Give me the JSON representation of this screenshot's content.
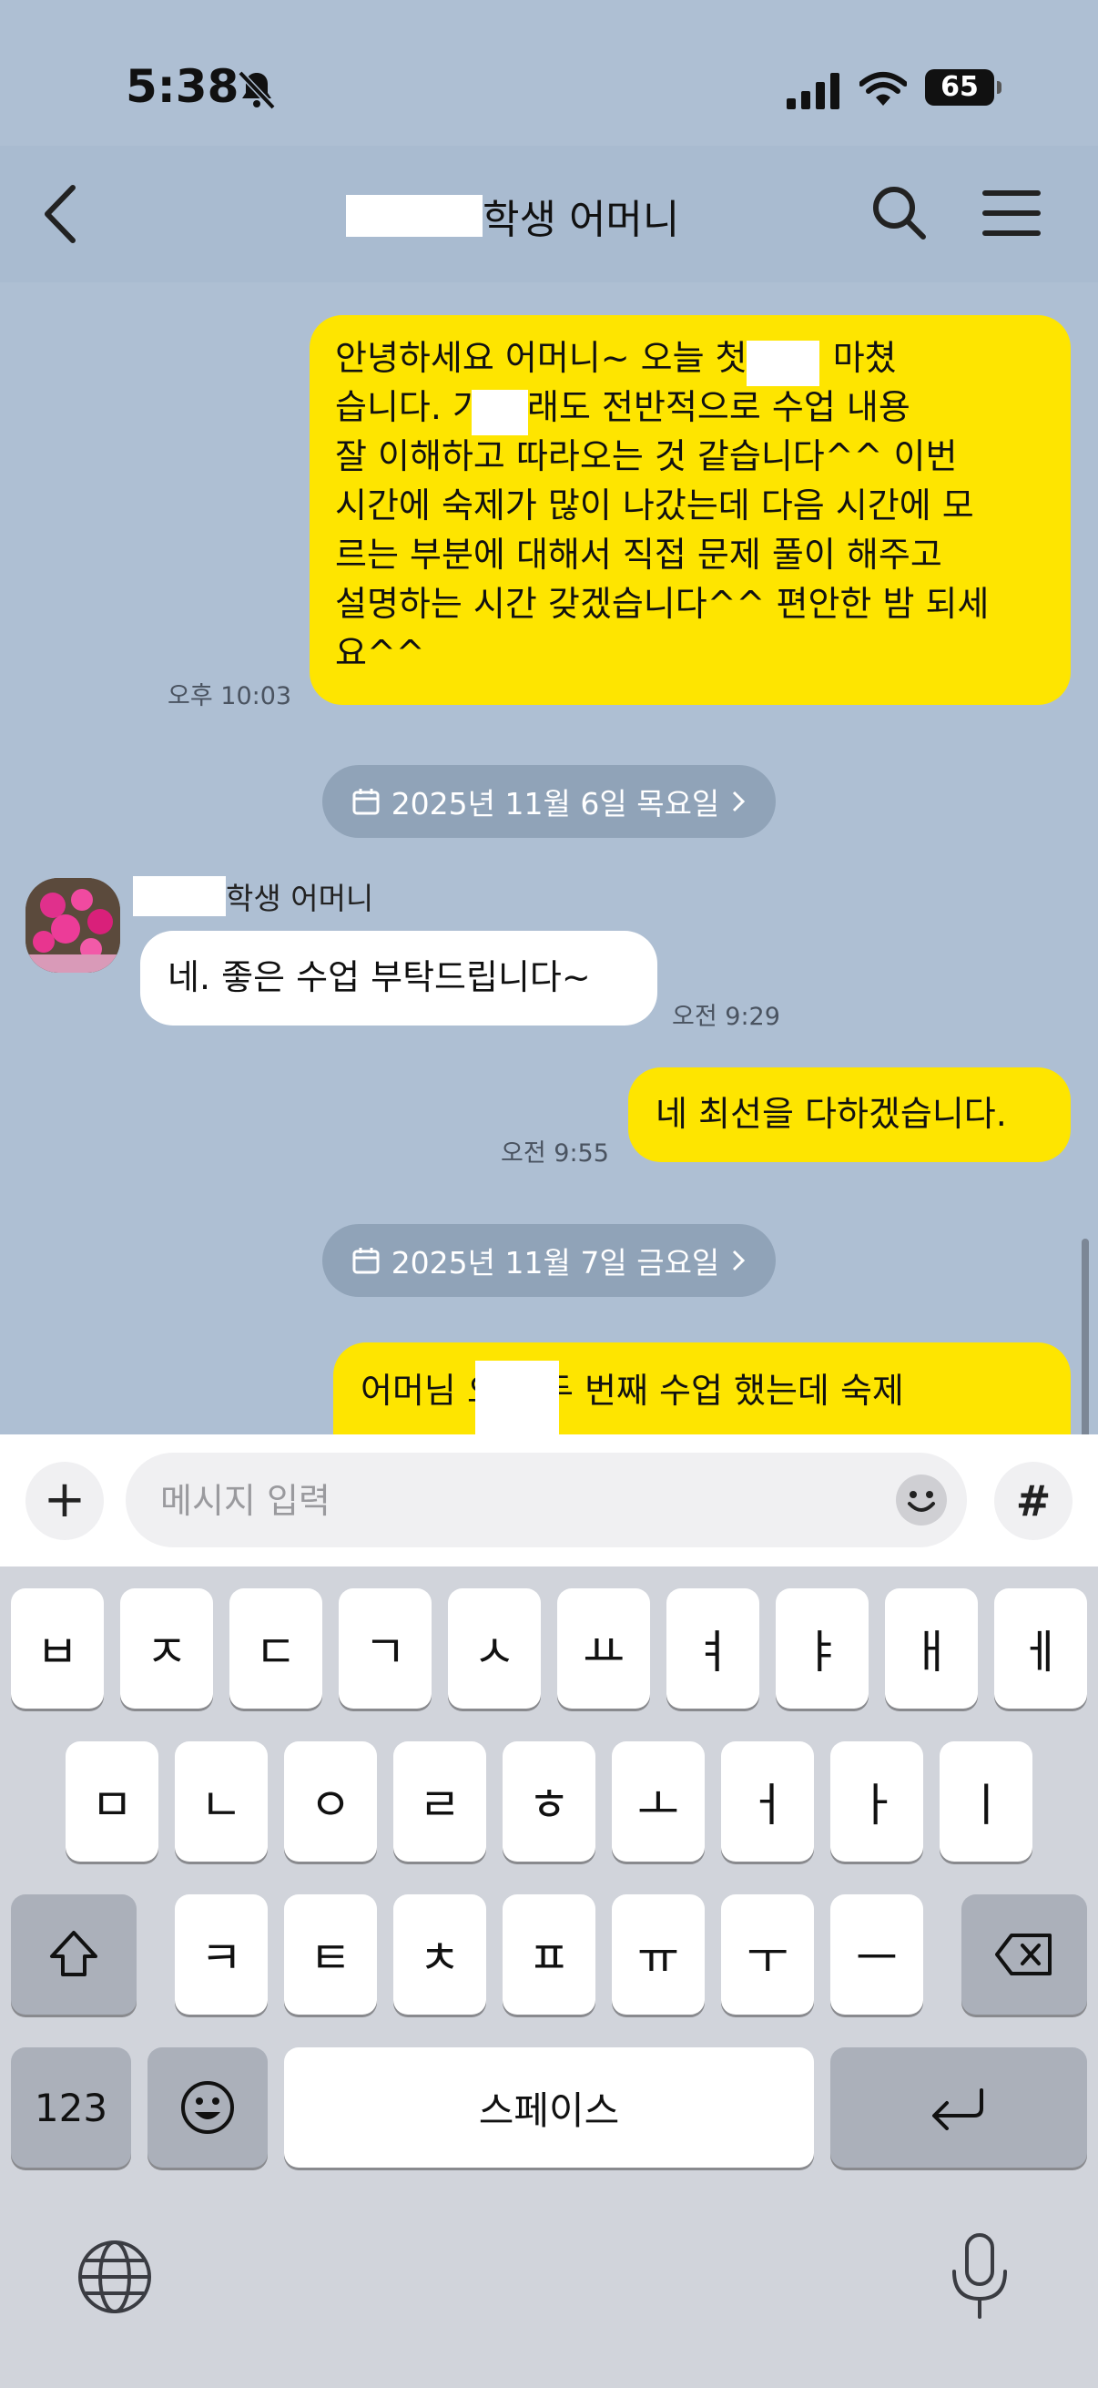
{
  "status": {
    "time": "5:38",
    "battery": "65"
  },
  "header": {
    "title": "학생  어머니"
  },
  "messages": [
    {
      "id": "m1",
      "side": "me",
      "text": "안녕하세요 어머니~ 오늘 ▢ 첫 수업 마쳤습니다. ▢가 그래도 전반적으로 수업 내용 잘 이해하고 따라오는 것 같습니다^^ 이번 시간에 숙제가 많이 나갔는데 다음 시간에 모르는 부분에 대해서 직접 문제 풀이 해주고 설명하는 시간 갖겠습니다^^ 편안한 밤 되세요^^",
      "lines": [
        "안녕하세요 어머니~ 오늘      첫 수업 마쳤",
        "습니다.       가 그래도 전반적으로 수업 내용",
        "잘 이해하고 따라오는 것 같습니다^^ 이번",
        "시간에 숙제가 많이 나갔는데 다음 시간에 모",
        "르는 부분에 대해서 직접 문제 풀이 해주고",
        "설명하는 시간 갖겠습니다^^ 편안한 밤 되세",
        "요^^"
      ],
      "time": "오후 10:03"
    },
    {
      "id": "d1",
      "type": "date",
      "text": "2025년 11월 6일 목요일"
    },
    {
      "id": "m2",
      "side": "other",
      "sender": "학생  어머니",
      "text": "네. 좋은 수업 부탁드립니다~",
      "time": "오전 9:29"
    },
    {
      "id": "m3",
      "side": "me",
      "text": "네 최선을 다하겠습니다.",
      "time": "오전 9:55"
    },
    {
      "id": "d2",
      "type": "date",
      "text": "2025년 11월 7일 금요일"
    },
    {
      "id": "m4",
      "side": "me",
      "text": "어머님       오늘 두 번째 수업 했는데 숙제"
    }
  ],
  "input": {
    "placeholder": "메시지 입력",
    "hash": "#",
    "plus": "+"
  },
  "keyboard": {
    "row1": [
      "ㅂ",
      "ㅈ",
      "ㄷ",
      "ㄱ",
      "ㅅ",
      "ㅛ",
      "ㅕ",
      "ㅑ",
      "ㅐ",
      "ㅔ"
    ],
    "row2": [
      "ㅁ",
      "ㄴ",
      "ㅇ",
      "ㄹ",
      "ㅎ",
      "ㅗ",
      "ㅓ",
      "ㅏ",
      "ㅣ"
    ],
    "row3": [
      "ㅋ",
      "ㅌ",
      "ㅊ",
      "ㅍ",
      "ㅠ",
      "ㅜ",
      "ㅡ"
    ],
    "numbers": "123",
    "space": "스페이스"
  },
  "icons": [
    "bell-slash-icon",
    "signal-icon",
    "wifi-icon",
    "back-icon",
    "search-icon",
    "menu-icon",
    "calendar-icon",
    "chevron-right-icon",
    "emoji-icon",
    "shift-icon",
    "delete-icon",
    "return-icon",
    "globe-icon",
    "microphone-icon"
  ]
}
